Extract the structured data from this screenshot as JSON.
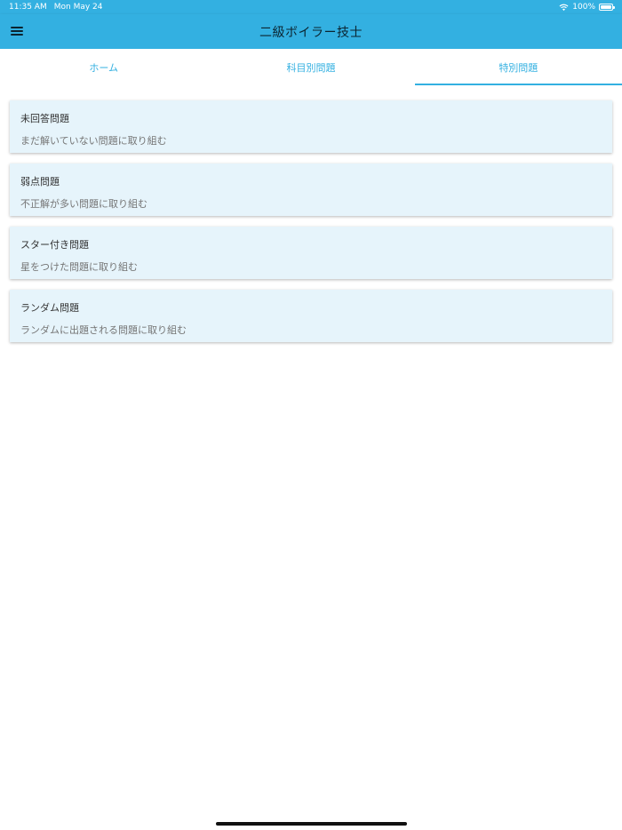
{
  "status_bar": {
    "time": "11:35 AM",
    "date": "Mon May 24",
    "battery": "100%",
    "wifi_icon": "wifi-icon",
    "battery_icon": "battery-icon"
  },
  "app_bar": {
    "title": "二級ボイラー技士",
    "menu_icon": "hamburger-menu-icon",
    "background": "#33b0e1"
  },
  "tabs": [
    {
      "label": "ホーム",
      "active": false
    },
    {
      "label": "科目別問題",
      "active": false
    },
    {
      "label": "特別問題",
      "active": true
    }
  ],
  "cards": [
    {
      "title": "未回答問題",
      "subtitle": "まだ解いていない問題に取り組む"
    },
    {
      "title": "弱点問題",
      "subtitle": "不正解が多い問題に取り組む"
    },
    {
      "title": "スター付き問題",
      "subtitle": "星をつけた問題に取り組む"
    },
    {
      "title": "ランダム問題",
      "subtitle": "ランダムに出題される問題に取り組む"
    }
  ],
  "colors": {
    "accent": "#33b0e1",
    "card_background": "#e6f4fb"
  }
}
